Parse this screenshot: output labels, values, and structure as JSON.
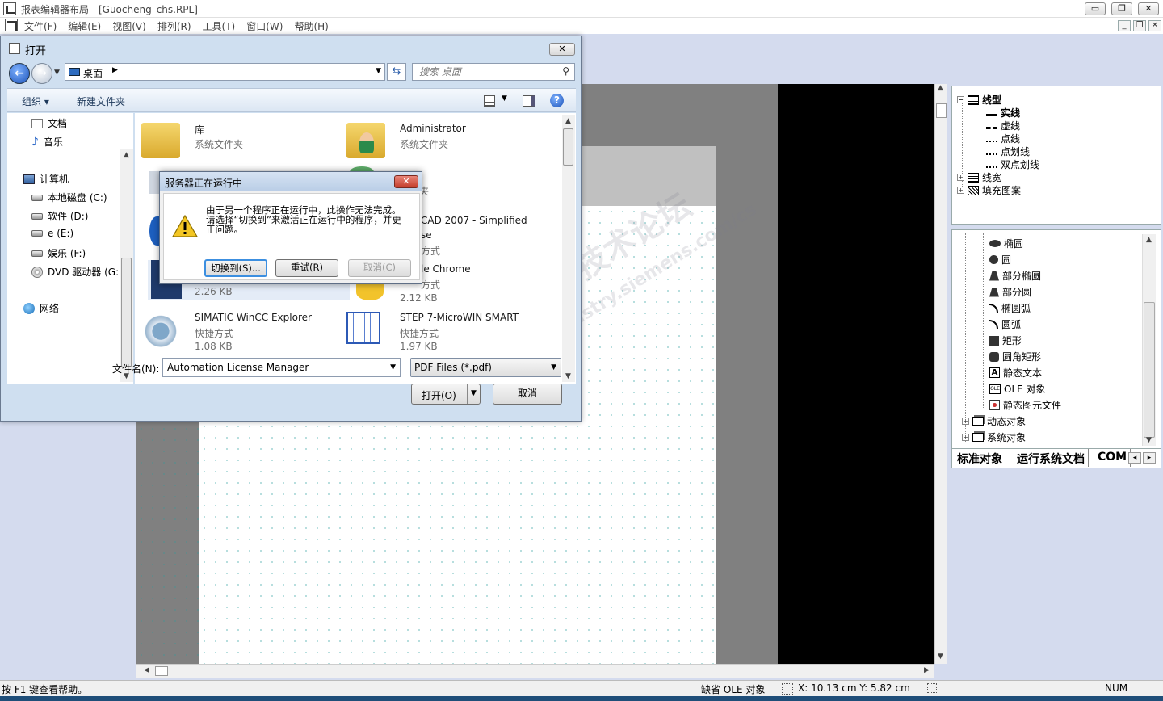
{
  "app": {
    "title": "报表编辑器布局 - [Guocheng_chs.RPL]",
    "caption_buttons": [
      "▭",
      "❐",
      "✕"
    ],
    "mdi_buttons": [
      "_",
      "❐",
      "✕"
    ]
  },
  "menubar": {
    "items": [
      "文件(F)",
      "编辑(E)",
      "视图(V)",
      "排列(R)",
      "工具(T)",
      "窗口(W)",
      "帮助(H)"
    ]
  },
  "linetype_panel": {
    "root": "线型",
    "children": [
      "实线",
      "虚线",
      "点线",
      "点划线",
      "双点划线"
    ],
    "siblings": [
      "线宽",
      "填充图案"
    ]
  },
  "objects_panel": {
    "items": [
      "椭圆",
      "圆",
      "部分椭圆",
      "部分圆",
      "椭圆弧",
      "圆弧",
      "矩形",
      "圆角矩形",
      "静态文本",
      "OLE 对象",
      "静态图元文件"
    ],
    "groups": [
      "动态对象",
      "系统对象"
    ],
    "ole_icon_text": "OLE",
    "text_icon_text": "A"
  },
  "panel_tabs": {
    "tabs": [
      "标准对象",
      "运行系统文档",
      "COM"
    ],
    "prev": "◂",
    "next": "▸"
  },
  "statusbar": {
    "help": "按 F1 键查看帮助。",
    "missing": "缺省 OLE 对象",
    "coords": "X: 10.13 cm Y: 5.82 cm",
    "num": "NUM"
  },
  "open_dialog": {
    "title": "打开",
    "close": "✕",
    "address": "桌面",
    "search_placeholder": "搜索 桌面",
    "organize": "组织 ▾",
    "new_folder": "新建文件夹",
    "help_glyph": "?",
    "nav": [
      {
        "label": "文档",
        "icon": "document-icon"
      },
      {
        "label": "音乐",
        "icon": "music-icon"
      },
      {
        "label": "计算机",
        "icon": "computer-icon"
      },
      {
        "label": "本地磁盘 (C:)",
        "icon": "drive-icon"
      },
      {
        "label": "软件 (D:)",
        "icon": "drive-icon"
      },
      {
        "label": "e (E:)",
        "icon": "drive-icon"
      },
      {
        "label": "娱乐 (F:)",
        "icon": "drive-icon"
      },
      {
        "label": "DVD 驱动器 (G:)",
        "icon": "dvd-icon"
      },
      {
        "label": "网络",
        "icon": "network-icon"
      }
    ],
    "files": [
      {
        "name": "库",
        "type": "系统文件夹",
        "size": ""
      },
      {
        "name": "Administrator",
        "type": "系统文件夹",
        "size": ""
      },
      {
        "name": "",
        "type": "",
        "size": ""
      },
      {
        "name": "",
        "type": "文件夹",
        "size": ""
      },
      {
        "name": "",
        "type": "",
        "size": ""
      },
      {
        "name": "CAD 2007 - Simplified",
        "type": "se",
        "size": "方式"
      },
      {
        "name": "",
        "type": "",
        "size": "2.26 KB"
      },
      {
        "name": "le Chrome",
        "type": "方式",
        "size": "2.12 KB"
      },
      {
        "name": "SIMATIC WinCC Explorer",
        "type": "快捷方式",
        "size": "1.08 KB"
      },
      {
        "name": "STEP 7-MicroWIN SMART",
        "type": "快捷方式",
        "size": "1.97 KB"
      }
    ],
    "filename_label": "文件名(N):",
    "filename_value": "Automation License Manager",
    "filter": "PDF Files (*.pdf)",
    "open_label": "打开(O)",
    "cancel_label": "取消"
  },
  "busy_dialog": {
    "title": "服务器正在运行中",
    "close": "✕",
    "message": "由于另一个程序正在运行中，此操作无法完成。请选择“切换到”来激活正在运行中的程序，并更正问题。",
    "switch_label": "切换到(S)...",
    "retry_label": "重试(R)",
    "cancel_label": "取消(C)"
  },
  "watermark": {
    "line1": "西门子工业 技术论坛",
    "line2": "support.industry.siemens.com/cs"
  }
}
